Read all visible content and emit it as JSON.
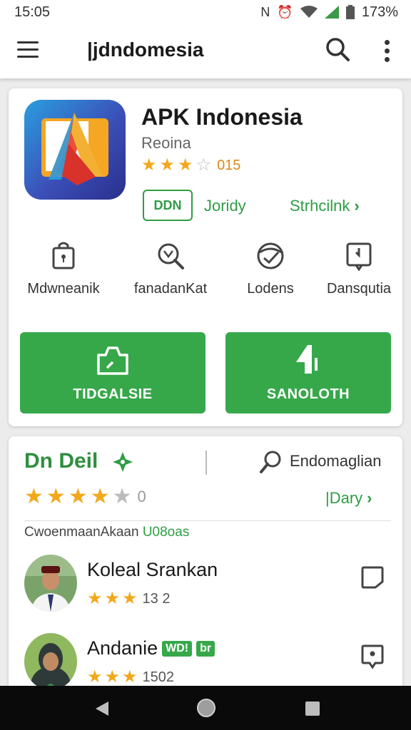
{
  "status_bar": {
    "time": "15:05",
    "battery": "173%"
  },
  "app_bar": {
    "title": "|jdndomesia"
  },
  "app": {
    "name": "APK Indonesia",
    "subtitle": "Reoina",
    "rating_text": "015",
    "stars": 3.5,
    "chip_label": "DDN",
    "link_a": "Joridy",
    "link_b": "Strhcilnk"
  },
  "features": [
    {
      "label": "Mdwneanik",
      "icon": "lock-icon"
    },
    {
      "label": "fanadanKat",
      "icon": "magnifier-icon"
    },
    {
      "label": "Lodens",
      "icon": "check-badge-icon"
    },
    {
      "label": "Dansqutia",
      "icon": "book-icon"
    }
  ],
  "actions": {
    "primary_label": "TIDGALSIE",
    "secondary_label": "SANOLOTH"
  },
  "reviews_section": {
    "title": "Dn Deil",
    "search_label": "Endomaglian",
    "rating_num": "0",
    "stars": 4.5,
    "day_link": "|Dary",
    "sub_heading_text": "Cwoenmaan",
    "sub_heading_mid": "Akaan",
    "sub_heading_green": "U08oas"
  },
  "reviews": [
    {
      "name": "Koleal Srankan",
      "rating_num": "13 2",
      "stars": 2.5,
      "badges": []
    },
    {
      "name": "Andanie",
      "rating_num": "1502",
      "stars": 2.5,
      "badges": [
        "WD!",
        "br"
      ]
    }
  ],
  "colors": {
    "accent_green": "#36a84a",
    "link_green": "#2f9d45",
    "star_gold": "#f2a81b",
    "nav_bar": "#0a0a0a"
  }
}
